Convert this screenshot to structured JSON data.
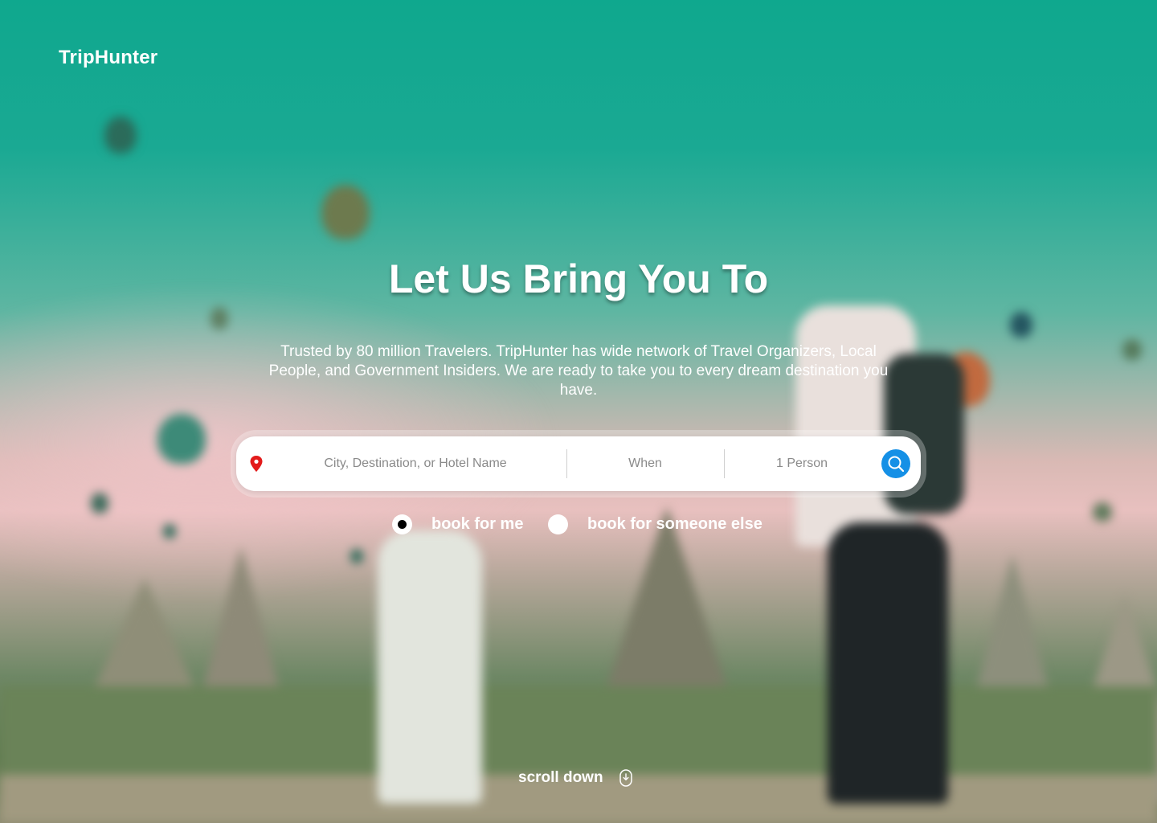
{
  "brand": {
    "name": "TripHunter"
  },
  "hero": {
    "headline": "Let Us Bring You To",
    "subtitle": "Trusted by 80 million Travelers. TripHunter has wide network of Travel Organizers, Local People, and Government Insiders. We are ready to take you to every dream destination you have."
  },
  "search": {
    "destination_placeholder": "City, Destination, or Hotel Name",
    "when_placeholder": "When",
    "guests_value": "1 Person",
    "location_icon": "location-pin-icon",
    "search_icon": "search-icon"
  },
  "booking_options": [
    {
      "label": "book for me",
      "selected": true
    },
    {
      "label": "book for someone else",
      "selected": false
    }
  ],
  "footer": {
    "scroll_label": "scroll down",
    "scroll_icon": "mouse-scroll-icon"
  },
  "colors": {
    "accent": "#1590E6",
    "pin": "#E31B1B",
    "sky": "#0FA88E"
  }
}
